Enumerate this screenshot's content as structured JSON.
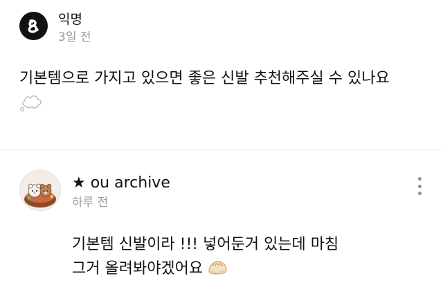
{
  "post": {
    "author": "익명",
    "time": "3일 전",
    "body": "기본템으로 가지고 있으면 좋은 신발 추천해주실 수 있나요",
    "avatar_icon": "anonymous-logo-icon",
    "emoji_icon": "thought-bubble-icon"
  },
  "comment": {
    "author": "★ ou archive",
    "time": "하루 전",
    "lines": [
      "기본템 신발이라 !!! 넣어둔거 있는데 마침",
      "그거 올려봐야겠어요"
    ],
    "avatar_icon": "bear-food-avatar",
    "emoji_icon": "dumpling-icon",
    "more_icon": "more-vertical-icon"
  },
  "colors": {
    "text": "#111111",
    "muted": "#9a9a9a",
    "divider": "#ececec",
    "avatar_dark": "#111111"
  }
}
